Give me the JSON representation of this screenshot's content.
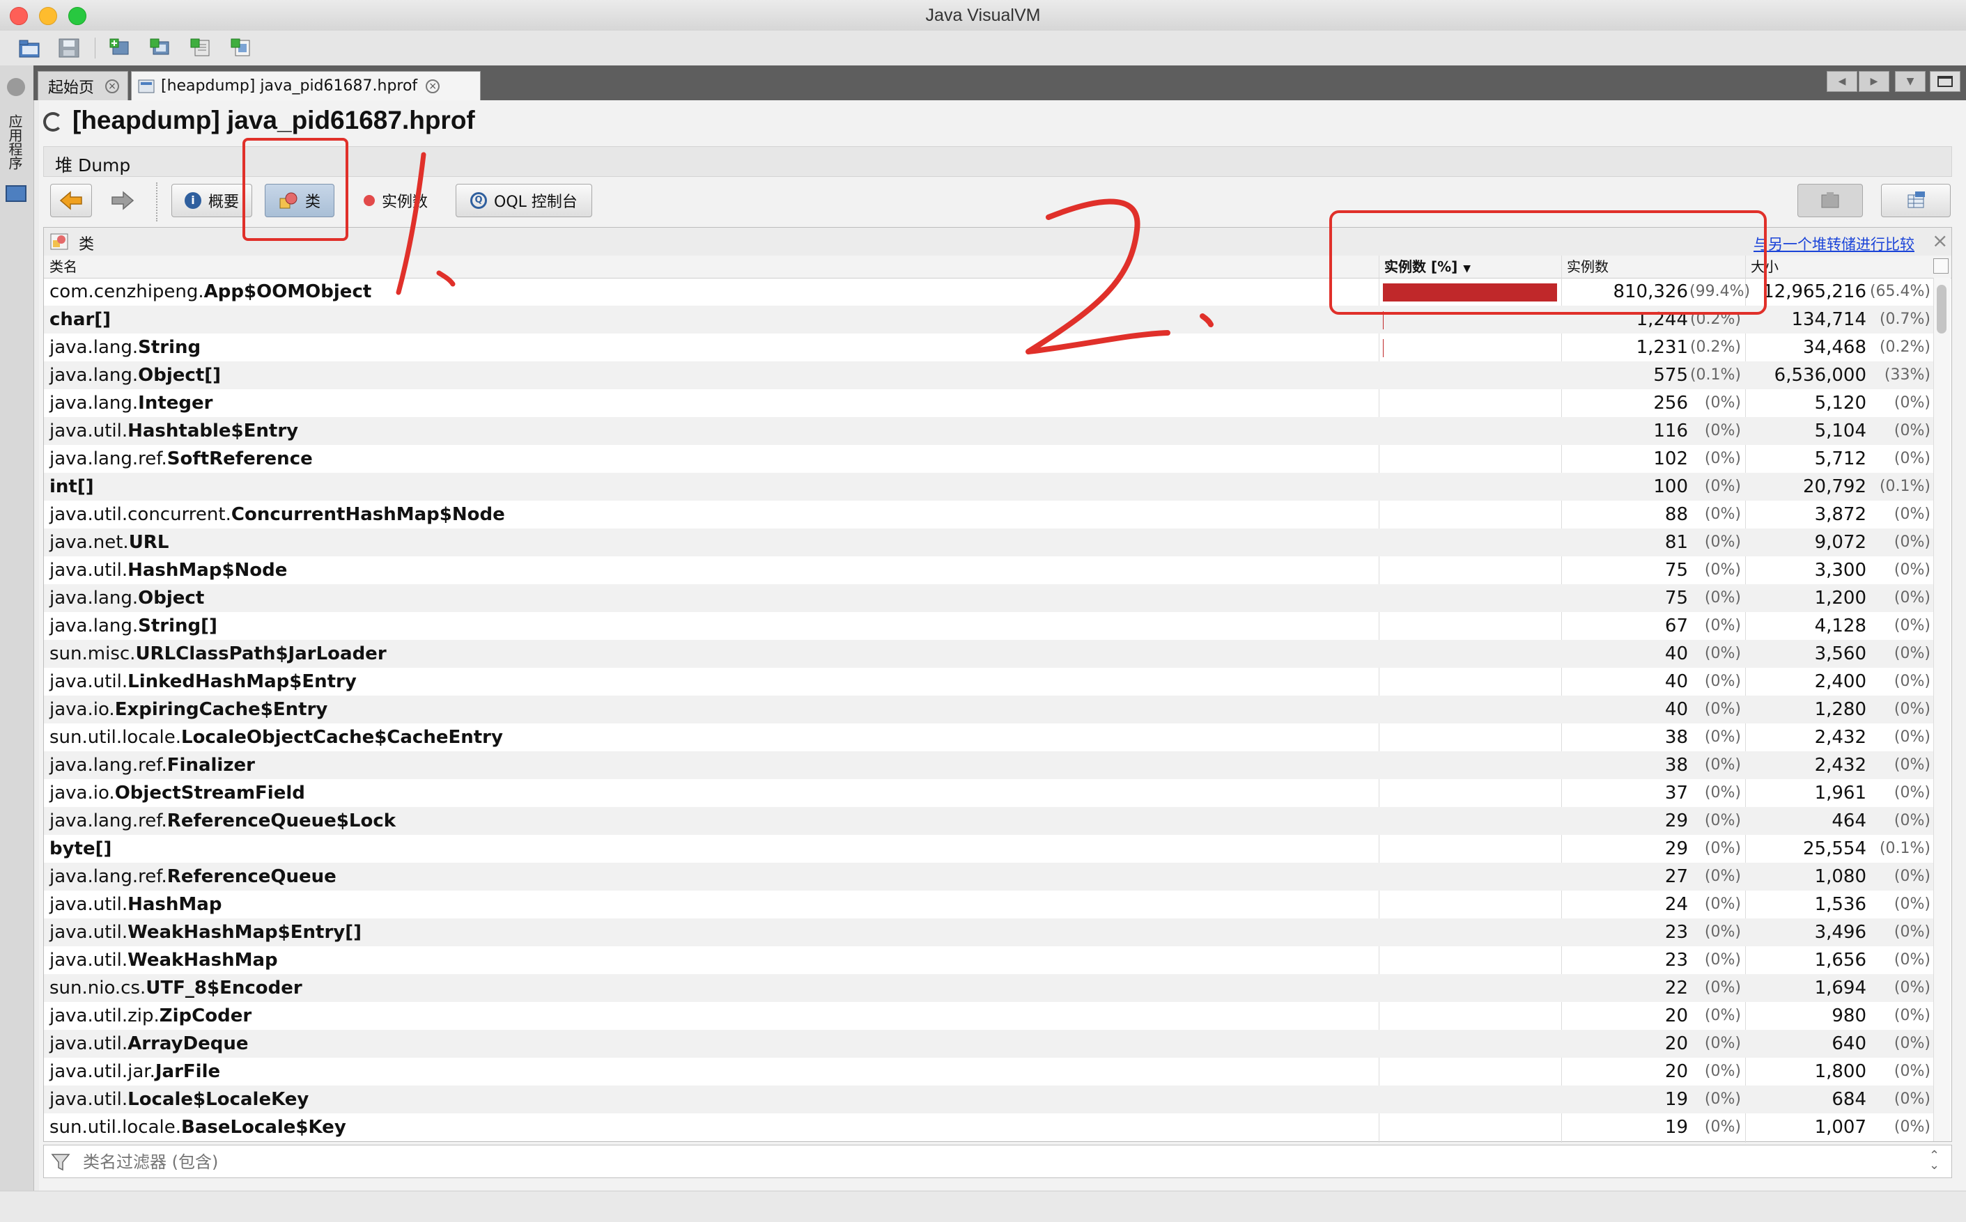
{
  "window": {
    "title": "Java VisualVM"
  },
  "sidebar": {
    "vertical_label": "应用程序"
  },
  "tabs": [
    {
      "label": "起始页"
    },
    {
      "label": "[heapdump] java_pid61687.hprof"
    }
  ],
  "doc": {
    "title": "[heapdump] java_pid61687.hprof",
    "section": "堆 Dump"
  },
  "views": {
    "summary": "概要",
    "classes": "类",
    "instances": "实例数",
    "oql": "OQL 控制台"
  },
  "panel": {
    "title": "类",
    "compare_link": "与另一个堆转储进行比较"
  },
  "columns": {
    "name": "类名",
    "instances_pct": "实例数 [%]",
    "instances": "实例数",
    "size": "大小"
  },
  "rows": [
    {
      "pre": "com.cenzhipeng.",
      "cls": "App$OOMObject",
      "inst": "810,326",
      "inst_pct": "(99.4%)",
      "size": "12,965,216",
      "size_pct": "(65.4%)",
      "bar": 0.994
    },
    {
      "pre": "",
      "cls": "char[]",
      "inst": "1,244",
      "inst_pct": "(0.2%)",
      "size": "134,714",
      "size_pct": "(0.7%)",
      "bar": 0.002
    },
    {
      "pre": "java.lang.",
      "cls": "String",
      "inst": "1,231",
      "inst_pct": "(0.2%)",
      "size": "34,468",
      "size_pct": "(0.2%)",
      "bar": 0.002
    },
    {
      "pre": "java.lang.",
      "cls": "Object[]",
      "inst": "575",
      "inst_pct": "(0.1%)",
      "size": "6,536,000",
      "size_pct": "(33%)",
      "bar": 0.001
    },
    {
      "pre": "java.lang.",
      "cls": "Integer",
      "inst": "256",
      "inst_pct": "(0%)",
      "size": "5,120",
      "size_pct": "(0%)",
      "bar": 0
    },
    {
      "pre": "java.util.",
      "cls": "Hashtable$Entry",
      "inst": "116",
      "inst_pct": "(0%)",
      "size": "5,104",
      "size_pct": "(0%)",
      "bar": 0
    },
    {
      "pre": "java.lang.ref.",
      "cls": "SoftReference",
      "inst": "102",
      "inst_pct": "(0%)",
      "size": "5,712",
      "size_pct": "(0%)",
      "bar": 0
    },
    {
      "pre": "",
      "cls": "int[]",
      "inst": "100",
      "inst_pct": "(0%)",
      "size": "20,792",
      "size_pct": "(0.1%)",
      "bar": 0
    },
    {
      "pre": "java.util.concurrent.",
      "cls": "ConcurrentHashMap$Node",
      "inst": "88",
      "inst_pct": "(0%)",
      "size": "3,872",
      "size_pct": "(0%)",
      "bar": 0
    },
    {
      "pre": "java.net.",
      "cls": "URL",
      "inst": "81",
      "inst_pct": "(0%)",
      "size": "9,072",
      "size_pct": "(0%)",
      "bar": 0
    },
    {
      "pre": "java.util.",
      "cls": "HashMap$Node",
      "inst": "75",
      "inst_pct": "(0%)",
      "size": "3,300",
      "size_pct": "(0%)",
      "bar": 0
    },
    {
      "pre": "java.lang.",
      "cls": "Object",
      "inst": "75",
      "inst_pct": "(0%)",
      "size": "1,200",
      "size_pct": "(0%)",
      "bar": 0
    },
    {
      "pre": "java.lang.",
      "cls": "String[]",
      "inst": "67",
      "inst_pct": "(0%)",
      "size": "4,128",
      "size_pct": "(0%)",
      "bar": 0
    },
    {
      "pre": "sun.misc.",
      "cls": "URLClassPath$JarLoader",
      "inst": "40",
      "inst_pct": "(0%)",
      "size": "3,560",
      "size_pct": "(0%)",
      "bar": 0
    },
    {
      "pre": "java.util.",
      "cls": "LinkedHashMap$Entry",
      "inst": "40",
      "inst_pct": "(0%)",
      "size": "2,400",
      "size_pct": "(0%)",
      "bar": 0
    },
    {
      "pre": "java.io.",
      "cls": "ExpiringCache$Entry",
      "inst": "40",
      "inst_pct": "(0%)",
      "size": "1,280",
      "size_pct": "(0%)",
      "bar": 0
    },
    {
      "pre": "sun.util.locale.",
      "cls": "LocaleObjectCache$CacheEntry",
      "inst": "38",
      "inst_pct": "(0%)",
      "size": "2,432",
      "size_pct": "(0%)",
      "bar": 0
    },
    {
      "pre": "java.lang.ref.",
      "cls": "Finalizer",
      "inst": "38",
      "inst_pct": "(0%)",
      "size": "2,432",
      "size_pct": "(0%)",
      "bar": 0
    },
    {
      "pre": "java.io.",
      "cls": "ObjectStreamField",
      "inst": "37",
      "inst_pct": "(0%)",
      "size": "1,961",
      "size_pct": "(0%)",
      "bar": 0
    },
    {
      "pre": "java.lang.ref.",
      "cls": "ReferenceQueue$Lock",
      "inst": "29",
      "inst_pct": "(0%)",
      "size": "464",
      "size_pct": "(0%)",
      "bar": 0
    },
    {
      "pre": "",
      "cls": "byte[]",
      "inst": "29",
      "inst_pct": "(0%)",
      "size": "25,554",
      "size_pct": "(0.1%)",
      "bar": 0
    },
    {
      "pre": "java.lang.ref.",
      "cls": "ReferenceQueue",
      "inst": "27",
      "inst_pct": "(0%)",
      "size": "1,080",
      "size_pct": "(0%)",
      "bar": 0
    },
    {
      "pre": "java.util.",
      "cls": "HashMap",
      "inst": "24",
      "inst_pct": "(0%)",
      "size": "1,536",
      "size_pct": "(0%)",
      "bar": 0
    },
    {
      "pre": "java.util.",
      "cls": "WeakHashMap$Entry[]",
      "inst": "23",
      "inst_pct": "(0%)",
      "size": "3,496",
      "size_pct": "(0%)",
      "bar": 0
    },
    {
      "pre": "java.util.",
      "cls": "WeakHashMap",
      "inst": "23",
      "inst_pct": "(0%)",
      "size": "1,656",
      "size_pct": "(0%)",
      "bar": 0
    },
    {
      "pre": "sun.nio.cs.",
      "cls": "UTF_8$Encoder",
      "inst": "22",
      "inst_pct": "(0%)",
      "size": "1,694",
      "size_pct": "(0%)",
      "bar": 0
    },
    {
      "pre": "java.util.zip.",
      "cls": "ZipCoder",
      "inst": "20",
      "inst_pct": "(0%)",
      "size": "980",
      "size_pct": "(0%)",
      "bar": 0
    },
    {
      "pre": "java.util.",
      "cls": "ArrayDeque",
      "inst": "20",
      "inst_pct": "(0%)",
      "size": "640",
      "size_pct": "(0%)",
      "bar": 0
    },
    {
      "pre": "java.util.jar.",
      "cls": "JarFile",
      "inst": "20",
      "inst_pct": "(0%)",
      "size": "1,800",
      "size_pct": "(0%)",
      "bar": 0
    },
    {
      "pre": "java.util.",
      "cls": "Locale$LocaleKey",
      "inst": "19",
      "inst_pct": "(0%)",
      "size": "684",
      "size_pct": "(0%)",
      "bar": 0
    },
    {
      "pre": "sun.util.locale.",
      "cls": "BaseLocale$Key",
      "inst": "19",
      "inst_pct": "(0%)",
      "size": "1,007",
      "size_pct": "(0%)",
      "bar": 0
    }
  ],
  "filter": {
    "placeholder": "类名过滤器 (包含)"
  },
  "colors": {
    "bar": "#c0282a",
    "annotation": "#e0302a",
    "link": "#1a43d8"
  }
}
